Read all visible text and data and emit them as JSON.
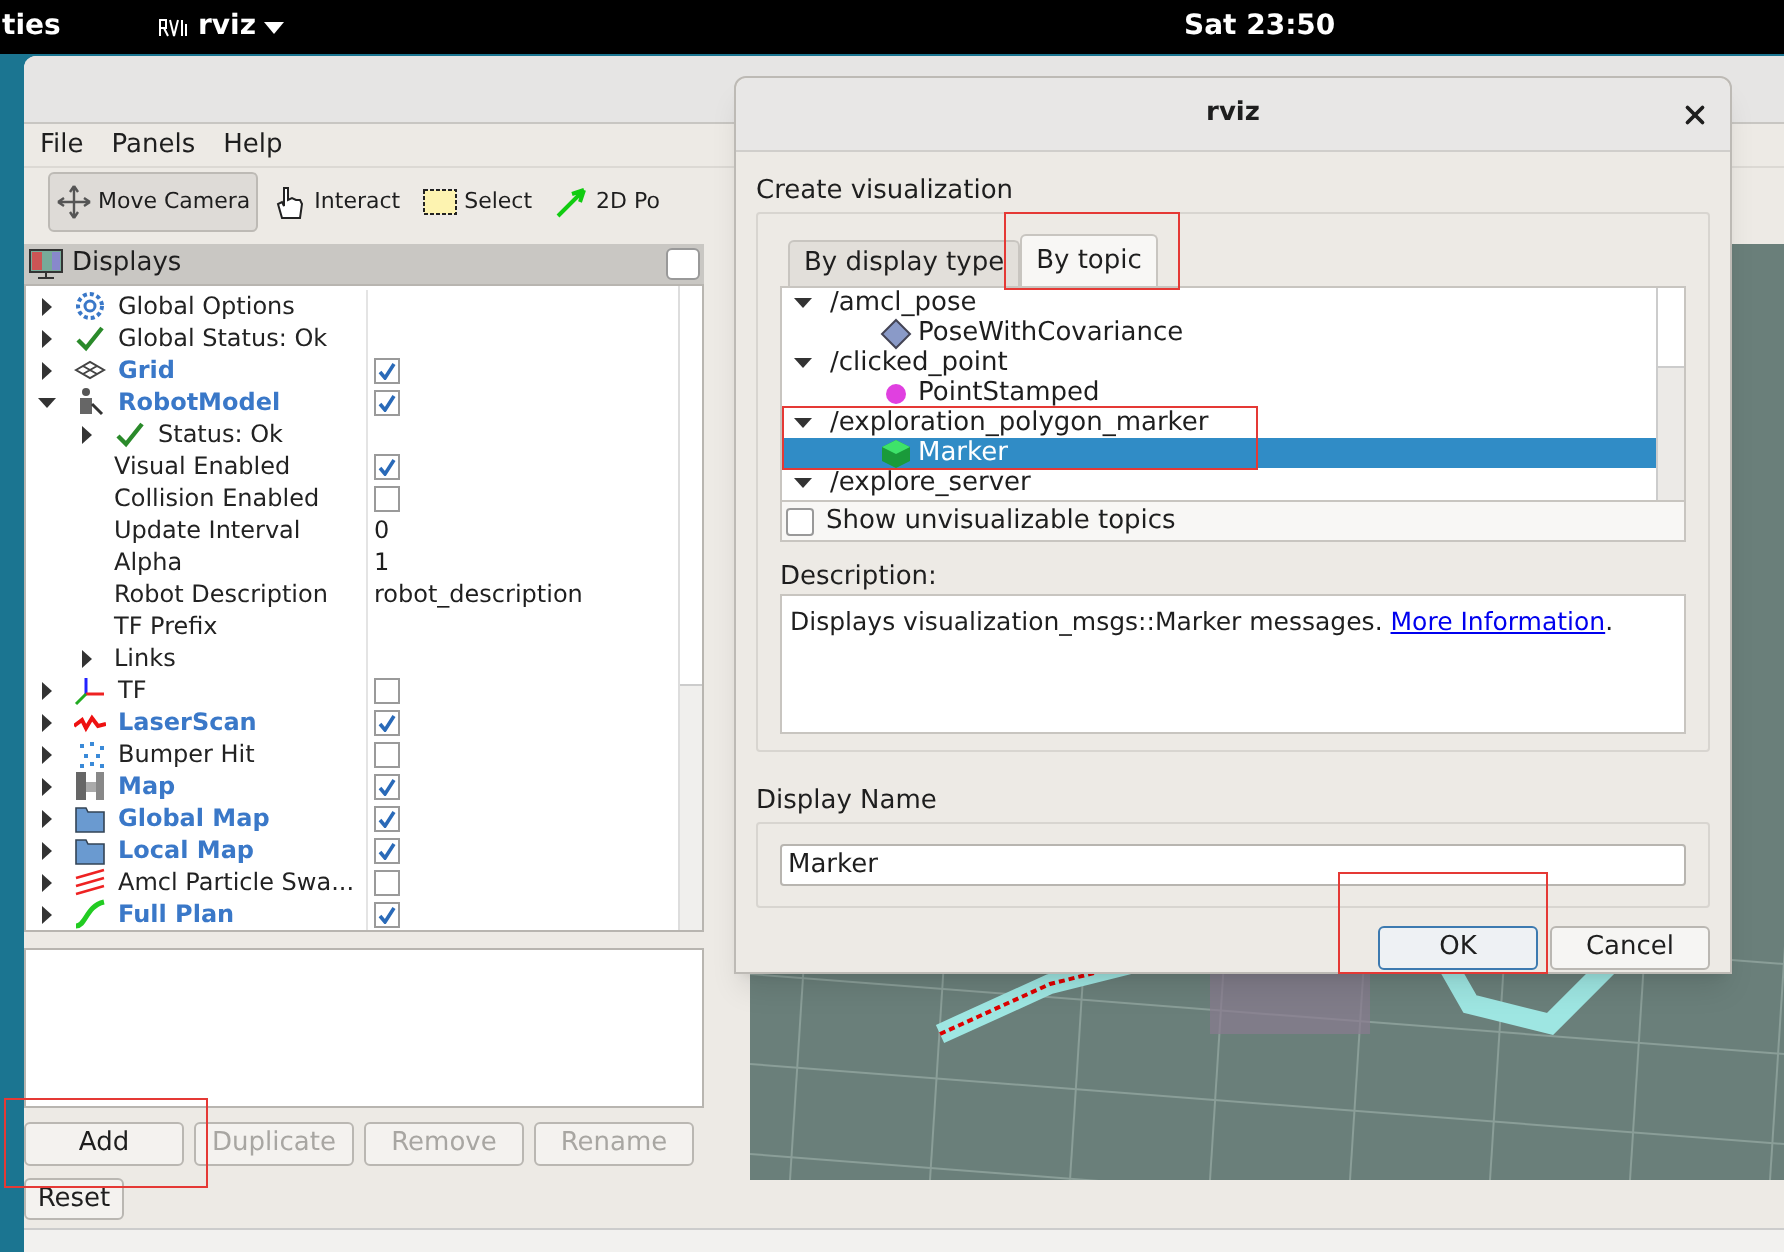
{
  "top_bar": {
    "activities": "ties",
    "app_menu": "rviz",
    "clock": "Sat 23:50"
  },
  "menu": [
    "File",
    "Panels",
    "Help"
  ],
  "toolbar": [
    {
      "label": "Move Camera",
      "kind": "move",
      "selected": true
    },
    {
      "label": "Interact",
      "kind": "hand",
      "selected": false
    },
    {
      "label": "Select",
      "kind": "select",
      "selected": false
    },
    {
      "label": "2D Po",
      "kind": "pose",
      "selected": false
    }
  ],
  "displays": {
    "title": "Displays",
    "items": [
      {
        "label": "Global Options",
        "kind": "options",
        "expanded": false
      },
      {
        "label": "Global Status: Ok",
        "kind": "status",
        "expanded": false
      },
      {
        "label": "Grid",
        "kind": "grid",
        "expanded": false,
        "checked": true
      },
      {
        "label": "RobotModel",
        "kind": "robot",
        "expanded": true,
        "checked": true,
        "children": [
          {
            "label": "Status: Ok",
            "kind": "status",
            "expanded": false
          },
          {
            "label": "Visual Enabled",
            "kind": "property",
            "checked": true
          },
          {
            "label": "Collision Enabled",
            "kind": "property",
            "checked": false
          },
          {
            "label": "Update Interval",
            "kind": "property",
            "value": "0"
          },
          {
            "label": "Alpha",
            "kind": "property",
            "value": "1"
          },
          {
            "label": "Robot Description",
            "kind": "property",
            "value": "robot_description"
          },
          {
            "label": "TF Prefix",
            "kind": "property"
          },
          {
            "label": "Links",
            "kind": "property",
            "expanded": false
          }
        ]
      },
      {
        "label": "TF",
        "kind": "tf",
        "expanded": false,
        "checked": false
      },
      {
        "label": "LaserScan",
        "kind": "laser",
        "expanded": false,
        "checked": true
      },
      {
        "label": "Bumper Hit",
        "kind": "points",
        "expanded": false,
        "checked": false
      },
      {
        "label": "Map",
        "kind": "map",
        "expanded": false,
        "checked": true
      },
      {
        "label": "Global Map",
        "kind": "folder",
        "expanded": false,
        "checked": true
      },
      {
        "label": "Local Map",
        "kind": "folder",
        "expanded": false,
        "checked": true
      },
      {
        "label": "Amcl Particle Swa...",
        "kind": "particles",
        "expanded": false,
        "checked": false
      },
      {
        "label": "Full Plan",
        "kind": "path",
        "expanded": false,
        "checked": true
      }
    ]
  },
  "panel_buttons": [
    {
      "label": "Add",
      "disabled": false
    },
    {
      "label": "Duplicate",
      "disabled": true
    },
    {
      "label": "Remove",
      "disabled": true
    },
    {
      "label": "Rename",
      "disabled": true
    }
  ],
  "reset_button": "Reset",
  "dialog": {
    "title": "rviz",
    "heading": "Create visualization",
    "tabs": [
      {
        "label": "By display type",
        "selected": false
      },
      {
        "label": "By topic",
        "selected": true
      }
    ],
    "topics": [
      {
        "label": "/amcl_pose",
        "expanded": true,
        "children": [
          {
            "label": "PoseWithCovariance",
            "kind": "pose",
            "selected": false
          }
        ]
      },
      {
        "label": "/clicked_point",
        "expanded": true,
        "children": [
          {
            "label": "PointStamped",
            "kind": "point",
            "selected": false
          }
        ]
      },
      {
        "label": "/exploration_polygon_marker",
        "expanded": true,
        "children": [
          {
            "label": "Marker",
            "kind": "marker",
            "selected": true
          }
        ]
      },
      {
        "label": "/explore_server",
        "expanded": true
      }
    ],
    "show_unvisualizable": {
      "label": "Show unvisualizable topics",
      "checked": false
    },
    "description_label": "Description:",
    "description": {
      "text": "Displays visualization_msgs::Marker messages. ",
      "link": "More Information",
      "after": "."
    },
    "display_name_label": "Display Name",
    "display_name": "Marker",
    "buttons": [
      {
        "label": "OK",
        "default": true
      },
      {
        "label": "Cancel",
        "default": false
      }
    ]
  }
}
